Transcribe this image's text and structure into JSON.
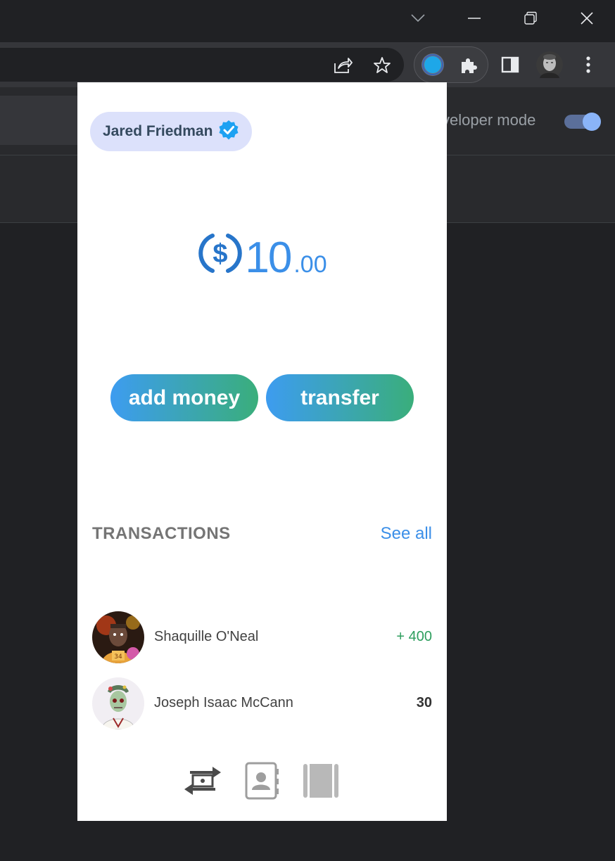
{
  "browser": {
    "window_controls": [
      "tab-search-chevron",
      "minimize",
      "restore",
      "close"
    ],
    "toolbar_icons": [
      "share-icon",
      "bookmark-star-icon",
      "wallet-extension-icon",
      "extensions-puzzle-icon",
      "side-panel-icon",
      "profile-avatar",
      "more-menu-icon"
    ]
  },
  "background_page": {
    "developer_mode_label": "veloper mode",
    "developer_mode_on": true
  },
  "popup": {
    "user": {
      "name": "Jared Friedman",
      "verified": true
    },
    "balance": {
      "currency_icon": "usdc-coin-icon",
      "whole": "10",
      "decimal": ".00"
    },
    "actions": {
      "add_money": "add money",
      "transfer": "transfer"
    },
    "transactions": {
      "title": "TRANSACTIONS",
      "see_all": "See all",
      "items": [
        {
          "name": "Shaquille O'Neal",
          "amount": "+ 400",
          "direction": "in",
          "avatar": "nft-avatar-basketball"
        },
        {
          "name": "Joseph Isaac McCann",
          "amount": "30",
          "direction": "out",
          "avatar": "nft-avatar-zombie"
        }
      ]
    },
    "bottom_nav": [
      "transfer-arrows-icon",
      "contacts-book-icon",
      "ledger-book-icon"
    ]
  },
  "colors": {
    "accent_blue": "#3b8fe8",
    "accent_green": "#3aae7b",
    "positive": "#2e9e5e",
    "chrome_dark": "#202124"
  }
}
